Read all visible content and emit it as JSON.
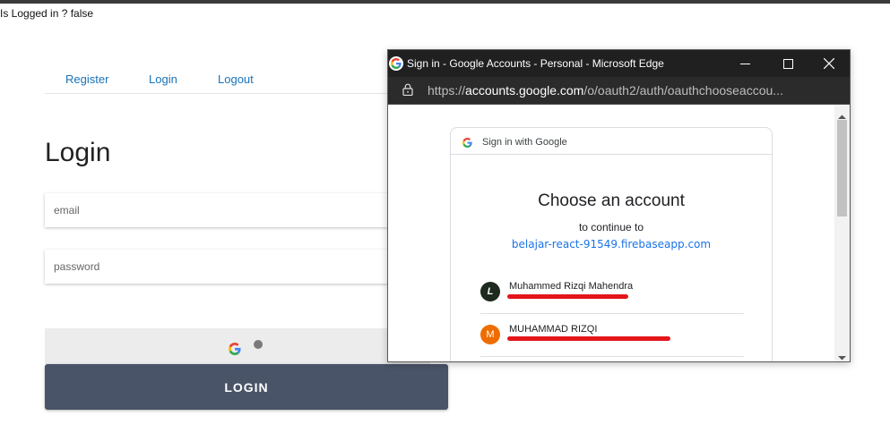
{
  "status": {
    "text": "Is Logged in ? false"
  },
  "nav": {
    "register": "Register",
    "login": "Login",
    "logout": "Logout"
  },
  "page": {
    "title": "Login"
  },
  "form": {
    "email_placeholder": "email",
    "password_placeholder": "password",
    "login_button": "LOGIN"
  },
  "popup": {
    "window_title": "Sign in - Google Accounts - Personal - Microsoft Edge",
    "url_prefix": "https://",
    "url_host": "accounts.google.com",
    "url_path": "/o/oauth2/auth/oauthchooseaccou...",
    "card": {
      "header": "Sign in with Google",
      "heading": "Choose an account",
      "subheading": "to continue to",
      "app_name": "belajar-react-91549.firebaseapp.com",
      "accounts": [
        {
          "name": "Muhammed Rizqi Mahendra",
          "avatar_letter": "L",
          "avatar_color": "#1e2a1e"
        },
        {
          "name": "MUHAMMAD RIZQI",
          "avatar_letter": "M",
          "avatar_color": "#ef6c00"
        }
      ]
    }
  },
  "colors": {
    "link": "#1a73b8",
    "login_button_bg": "#4a5468",
    "google_link": "#1a73e8",
    "redaction": "#e3151a"
  }
}
